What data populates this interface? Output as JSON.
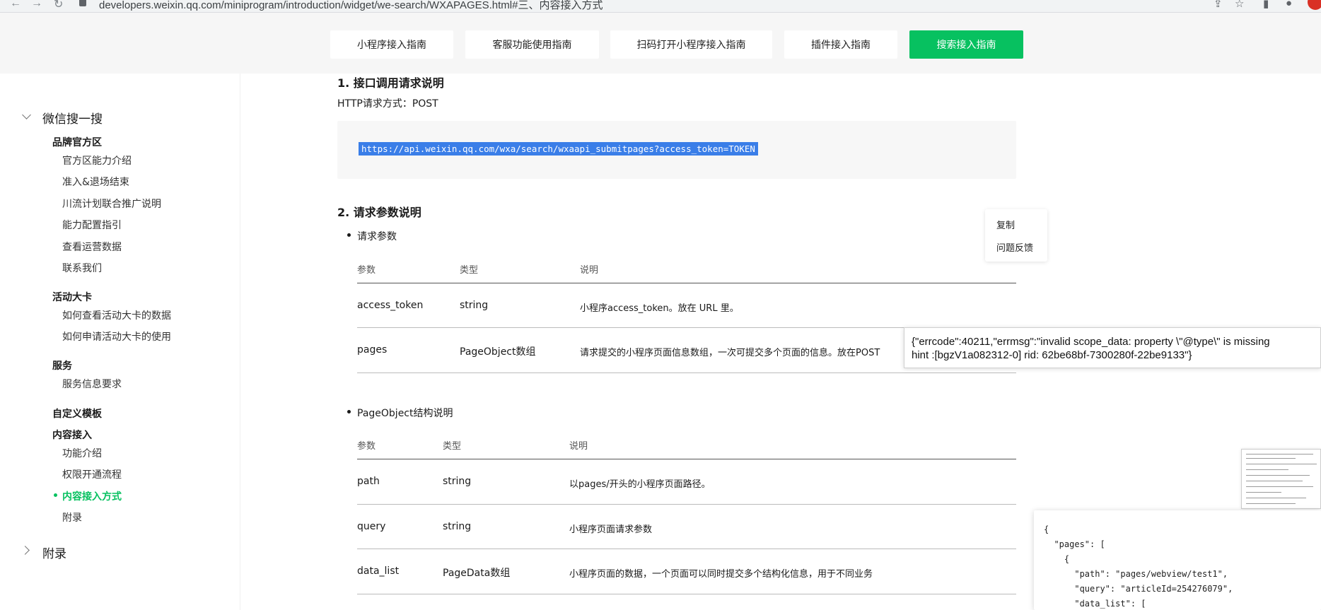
{
  "browser": {
    "url": "developers.weixin.qq.com/miniprogram/introduction/widget/we-search/WXAPAGES.html#三、内容接入方式"
  },
  "guide_tabs": [
    {
      "label": "小程序接入指南"
    },
    {
      "label": "客服功能使用指南"
    },
    {
      "label": "扫码打开小程序接入指南"
    },
    {
      "label": "插件接入指南"
    },
    {
      "label": "搜索接入指南",
      "active": true
    }
  ],
  "sidebar": {
    "group_title": "微信搜一搜",
    "sections": [
      {
        "title": "品牌官方区",
        "items": [
          "官方区能力介绍",
          "准入&退场结束",
          "川流计划联合推广说明",
          "能力配置指引",
          "查看运营数据",
          "联系我们"
        ]
      },
      {
        "title": "活动大卡",
        "items": [
          "如何查看活动大卡的数据",
          "如何申请活动大卡的使用"
        ]
      },
      {
        "title": "服务",
        "items": [
          "服务信息要求"
        ]
      },
      {
        "title": "自定义模板",
        "items": []
      },
      {
        "title": "内容接入",
        "items": [
          "功能介绍",
          "权限开通流程",
          "内容接入方式",
          "附录"
        ],
        "active_item": "内容接入方式"
      }
    ],
    "appendix": "附录"
  },
  "content": {
    "section1_title": "1. 接口调用请求说明",
    "http_method": "HTTP请求方式：POST",
    "api_url": "https://api.weixin.qq.com/wxa/search/wxaapi_submitpages?access_token=TOKEN",
    "section2_title": "2. 请求参数说明",
    "bullet1": "请求参数",
    "table1": {
      "headers": [
        "参数",
        "类型",
        "说明"
      ],
      "rows": [
        [
          "access_token",
          "string",
          "小程序access_token。放在 URL 里。"
        ],
        [
          "pages",
          "PageObject数组",
          "请求提交的小程序页面信息数组，一次可提交多个页面的信息。放在POST"
        ]
      ]
    },
    "bullet2": "PageObject结构说明",
    "table2": {
      "headers": [
        "参数",
        "类型",
        "说明"
      ],
      "rows": [
        [
          "path",
          "string",
          "以pages/开头的小程序页面路径。"
        ],
        [
          "query",
          "string",
          "小程序页面请求参数"
        ],
        [
          "data_list",
          "PageData数组",
          "小程序页面的数据，一个页面可以同时提交多个结构化信息，用于不同业务"
        ]
      ]
    }
  },
  "context_menu": {
    "items": [
      "复制",
      "问题反馈"
    ]
  },
  "error_tooltip": {
    "line1": "{\"errcode\":40211,\"errmsg\":\"invalid scope_data: property \\\"@type\\\" is missing",
    "line2": "hint :[bgzV1a082312-0] rid: 62be68bf-7300280f-22be9133\"}"
  },
  "json_popup": {
    "lines": [
      "{",
      "  \"pages\": [",
      "    {",
      "      \"path\": \"pages/webview/test1\",",
      "      \"query\": \"articleId=254276079\",",
      "      \"data_list\": ["
    ]
  },
  "colors": {
    "accent_green": "#07c160",
    "selection_blue": "#3a7ee8"
  }
}
